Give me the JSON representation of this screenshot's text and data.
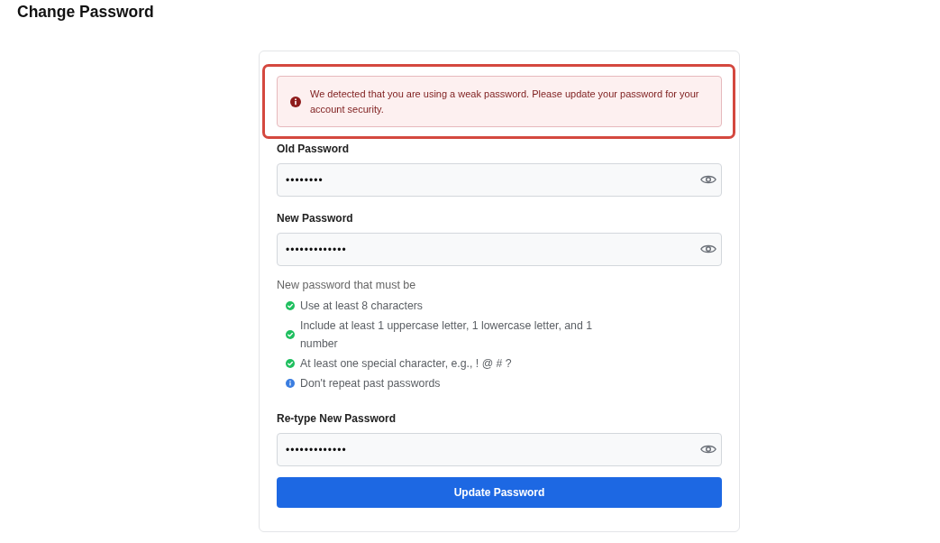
{
  "page": {
    "title": "Change Password"
  },
  "alert": {
    "message": "We detected that you are using a weak password. Please update your password for your account security.",
    "highlighted": true
  },
  "fields": [
    {
      "label": "Old Password",
      "value": "••••••••"
    },
    {
      "label": "New Password",
      "value": "•••••••••••••",
      "requirements": {
        "intro": "New password that must be",
        "items": [
          {
            "text": "Use at least 8 characters",
            "kind": "met"
          },
          {
            "text": "Include at least 1 uppercase letter, 1 lowercase letter, and 1 number",
            "kind": "met"
          },
          {
            "text": "At least one special character, e.g., ! @ # ?",
            "kind": "met"
          },
          {
            "text": "Don't repeat past passwords",
            "kind": "info"
          }
        ]
      }
    },
    {
      "label": "Re-type New Password",
      "value": "•••••••••••••"
    }
  ],
  "button": {
    "label": "Update Password"
  }
}
